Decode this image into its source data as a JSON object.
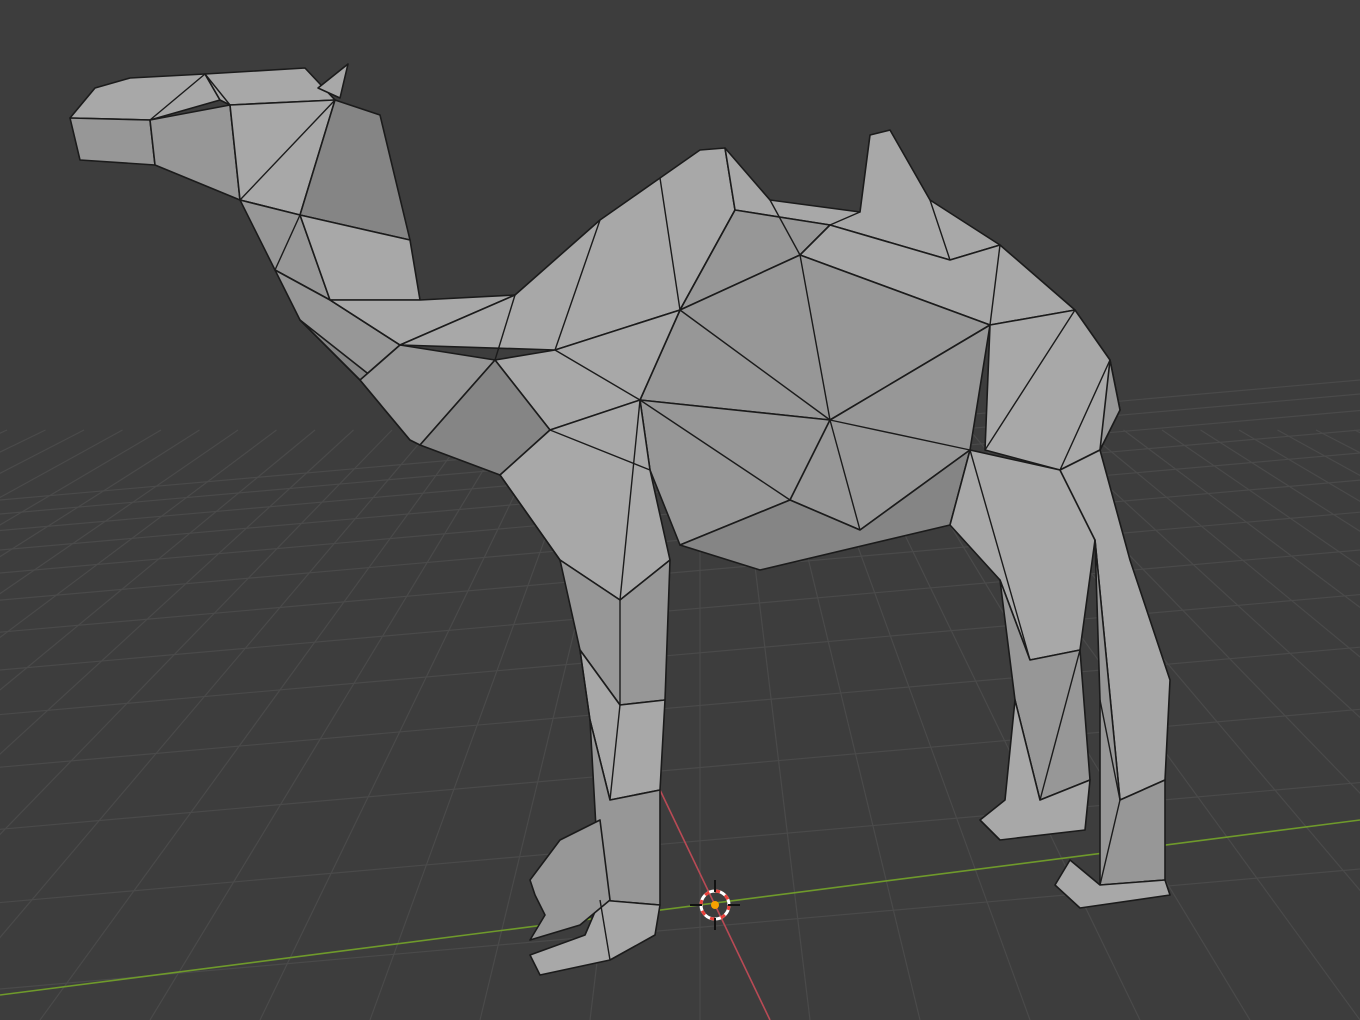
{
  "viewport": {
    "background_color": "#3d3d3d",
    "grid_color": "#4a4a4a",
    "x_axis_color": "#b84a55",
    "y_axis_color": "#6f9a2b",
    "mesh_light_color": "#a8a8a8",
    "mesh_mid_color": "#979797",
    "mesh_dark_color": "#858585",
    "mesh_edge_color": "#1b1b1b",
    "origin_marker_color": "#f7a100",
    "cursor_ring_colors": [
      "#e8403a",
      "#ffffff"
    ]
  },
  "object": {
    "icon": "low-poly-camel-mesh"
  },
  "cursor": {
    "icon": "3d-cursor-icon"
  }
}
